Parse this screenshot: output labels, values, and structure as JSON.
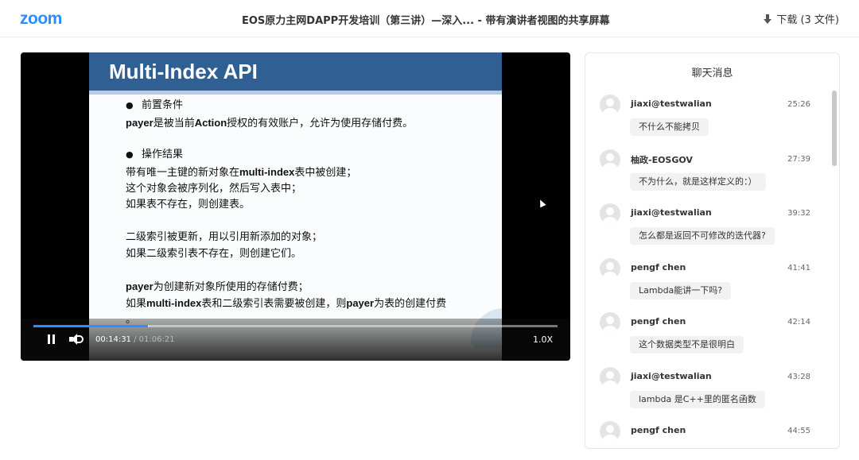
{
  "header": {
    "logo": "zoom",
    "title": "EOS原力主网DAPP开发培训（第三讲）—深入...  - 带有演讲者视图的共享屏幕",
    "download_label": "下载 (3 文件)",
    "download_icon": "download-arrow-icon"
  },
  "slide": {
    "title": "Multi-Index API",
    "lines": [
      {
        "bullet": true,
        "text": "前置条件"
      },
      {
        "bold": "payer",
        "text": "是被当前",
        "bold2": "Action",
        "text2": "授权的有效账户，允许为使用存储付费。"
      },
      {
        "bullet": true,
        "text": "操作结果"
      },
      {
        "text": "带有唯一主键的新对象在",
        "bold": "multi-index",
        "text2": "表中被创建；"
      },
      {
        "text": "这个对象会被序列化，然后写入表中；"
      },
      {
        "text": "如果表不存在，则创建表。"
      },
      {
        "text": "二级索引被更新，用以引用新添加的对象；"
      },
      {
        "text": "如果二级索引表不存在，则创建它们。"
      },
      {
        "bold": "payer",
        "text": "为创建新对象所使用的存储付费；"
      },
      {
        "text": "如果",
        "bold": "multi-index",
        "text2": "表和二级索引表需要被创建，则",
        "bold2": "payer",
        "text3": "为表的创建付费"
      },
      {
        "text": "。"
      }
    ]
  },
  "player": {
    "current_time": "00:14:31",
    "separator": " / ",
    "duration": "01:06:21",
    "speed": "1.0X",
    "played_fraction": 0.219,
    "buffered_fraction": 0.22,
    "accent": "#2D8CFF"
  },
  "chat": {
    "title": "聊天消息",
    "messages": [
      {
        "sender": "jiaxi@testwalian",
        "time": "25:26",
        "text": "不什么不能拷贝"
      },
      {
        "sender": "柚政-EOSGOV",
        "time": "27:39",
        "text": "不为什么，就是这样定义的：）"
      },
      {
        "sender": "jiaxi@testwalian",
        "time": "39:32",
        "text": "怎么都是返回不可修改的迭代器?"
      },
      {
        "sender": "pengf chen",
        "time": "41:41",
        "text": "Lambda能讲一下吗?"
      },
      {
        "sender": "pengf chen",
        "time": "42:14",
        "text": "这个数据类型不是很明白"
      },
      {
        "sender": "jiaxi@testwalian",
        "time": "43:28",
        "text": "lambda 是C++里的匿名函数"
      },
      {
        "sender": "pengf chen",
        "time": "44:55",
        "text": ""
      }
    ]
  }
}
